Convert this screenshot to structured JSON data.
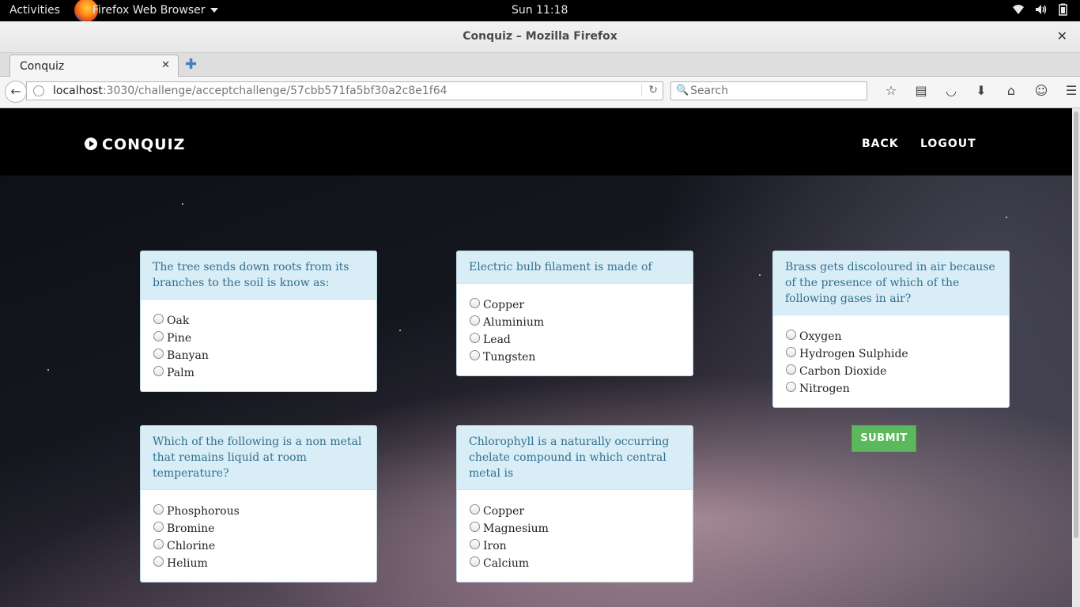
{
  "topbar": {
    "activities": "Activities",
    "app_menu": "Firefox Web Browser",
    "clock": "Sun 11:18",
    "tray_icons": [
      "wifi-icon",
      "volume-icon",
      "battery-icon"
    ]
  },
  "window": {
    "title": "Conquiz – Mozilla Firefox"
  },
  "tabs": [
    {
      "label": "Conquiz"
    }
  ],
  "navbar": {
    "url_host": "localhost",
    "url_rest": ":3030/challenge/acceptchallenge/57cbb571fa5bf30a2c8e1f64",
    "search_placeholder": "Search"
  },
  "site": {
    "brand": "CONQUIZ",
    "nav": {
      "back": "BACK",
      "logout": "LOGOUT"
    }
  },
  "questions": [
    {
      "text": "The tree sends down roots from its branches to the soil is know as:",
      "options": [
        "Oak",
        "Pine",
        "Banyan",
        "Palm"
      ]
    },
    {
      "text": "Electric bulb filament is made of",
      "options": [
        "Copper",
        "Aluminium",
        "Lead",
        "Tungsten"
      ]
    },
    {
      "text": "Brass gets discoloured in air because of the presence of which of the following gases in air?",
      "options": [
        "Oxygen",
        "Hydrogen Sulphide",
        "Carbon Dioxide",
        "Nitrogen"
      ]
    },
    {
      "text": "Which of the following is a non metal that remains liquid at room temperature?",
      "options": [
        "Phosphorous",
        "Bromine",
        "Chlorine",
        "Helium"
      ]
    },
    {
      "text": "Chlorophyll is a naturally occurring chelate compound in which central metal is",
      "options": [
        "Copper",
        "Magnesium",
        "Iron",
        "Calcium"
      ]
    }
  ],
  "submit_label": "SUBMIT",
  "colors": {
    "submit": "#5cb85c",
    "question_header_bg": "#d9edf7",
    "question_header_text": "#31708f"
  }
}
